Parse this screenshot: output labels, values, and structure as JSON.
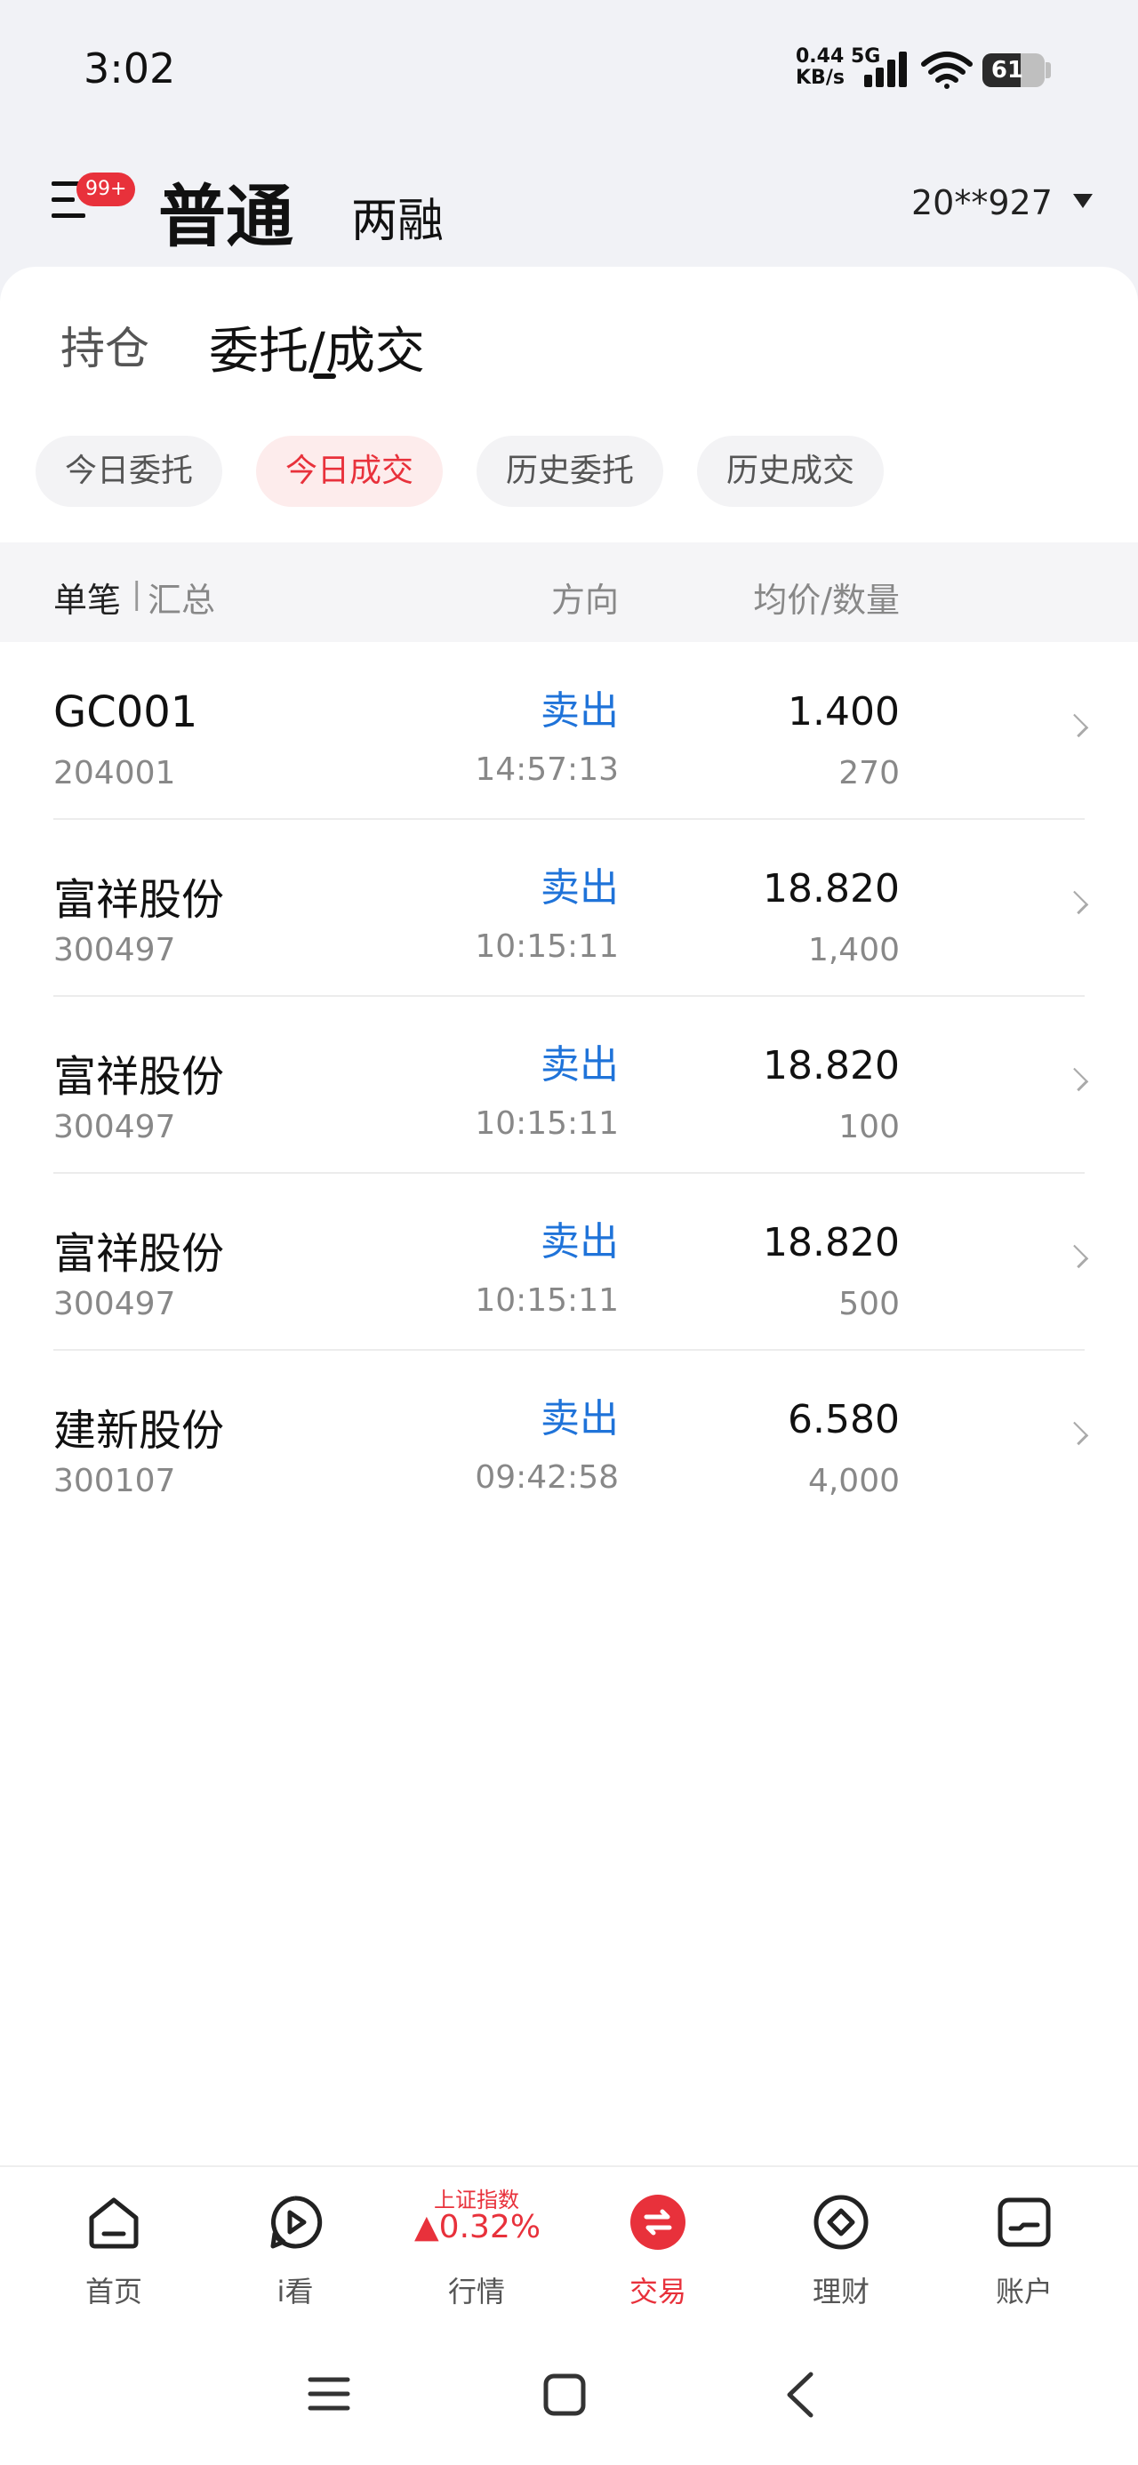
{
  "status_bar": {
    "time": "3:02",
    "net_speed_value": "0.44",
    "net_speed_unit": "KB/s",
    "network_type": "5G",
    "battery_level": "61",
    "battery_fraction": 0.61
  },
  "header": {
    "menu_badge": "99+",
    "mode_normal": "普通",
    "mode_margin": "两融",
    "account": "20**927"
  },
  "tabs": {
    "positions": "持仓",
    "orders_left": "委托",
    "orders_sep": "/",
    "orders_right": "成交"
  },
  "filters": [
    {
      "label": "今日委托",
      "active": false
    },
    {
      "label": "今日成交",
      "active": true
    },
    {
      "label": "历史委托",
      "active": false
    },
    {
      "label": "历史成交",
      "active": false
    }
  ],
  "table_header": {
    "single": "单笔",
    "sep": "|",
    "total": "汇总",
    "direction": "方向",
    "price_qty": "均价/数量"
  },
  "trades": [
    {
      "name": "GC001",
      "code": "204001",
      "direction": "卖出",
      "time": "14:57:13",
      "price": "1.400",
      "qty": "270"
    },
    {
      "name": "富祥股份",
      "code": "300497",
      "direction": "卖出",
      "time": "10:15:11",
      "price": "18.820",
      "qty": "1,400"
    },
    {
      "name": "富祥股份",
      "code": "300497",
      "direction": "卖出",
      "time": "10:15:11",
      "price": "18.820",
      "qty": "100"
    },
    {
      "name": "富祥股份",
      "code": "300497",
      "direction": "卖出",
      "time": "10:15:11",
      "price": "18.820",
      "qty": "500"
    },
    {
      "name": "建新股份",
      "code": "300107",
      "direction": "卖出",
      "time": "09:42:58",
      "price": "6.580",
      "qty": "4,000"
    }
  ],
  "bottom_nav": {
    "home": "首页",
    "watch": "i看",
    "market_index_name": "上证指数",
    "market_index_change": "▲0.32%",
    "market": "行情",
    "trade": "交易",
    "finance": "理财",
    "account": "账户"
  },
  "colors": {
    "accent_red": "#e8313b",
    "sell_blue": "#1f73d9"
  }
}
